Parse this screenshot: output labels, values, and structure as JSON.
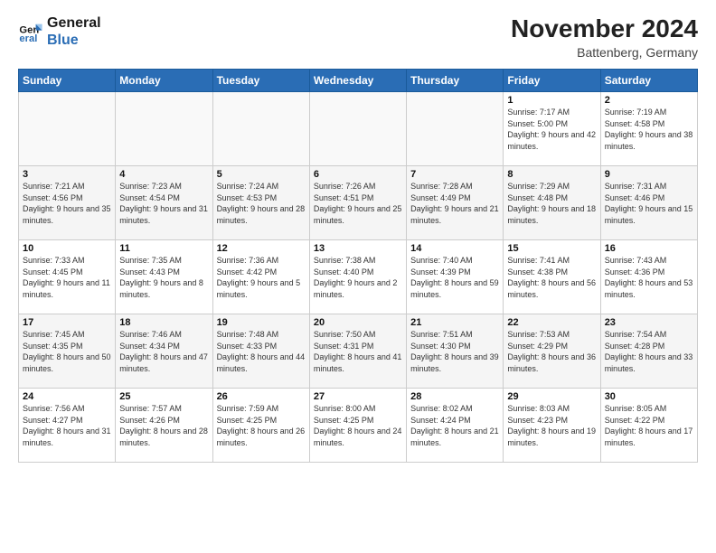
{
  "header": {
    "logo_line1": "General",
    "logo_line2": "Blue",
    "month_year": "November 2024",
    "location": "Battenberg, Germany"
  },
  "weekdays": [
    "Sunday",
    "Monday",
    "Tuesday",
    "Wednesday",
    "Thursday",
    "Friday",
    "Saturday"
  ],
  "weeks": [
    [
      {
        "day": "",
        "info": ""
      },
      {
        "day": "",
        "info": ""
      },
      {
        "day": "",
        "info": ""
      },
      {
        "day": "",
        "info": ""
      },
      {
        "day": "",
        "info": ""
      },
      {
        "day": "1",
        "info": "Sunrise: 7:17 AM\nSunset: 5:00 PM\nDaylight: 9 hours and 42 minutes."
      },
      {
        "day": "2",
        "info": "Sunrise: 7:19 AM\nSunset: 4:58 PM\nDaylight: 9 hours and 38 minutes."
      }
    ],
    [
      {
        "day": "3",
        "info": "Sunrise: 7:21 AM\nSunset: 4:56 PM\nDaylight: 9 hours and 35 minutes."
      },
      {
        "day": "4",
        "info": "Sunrise: 7:23 AM\nSunset: 4:54 PM\nDaylight: 9 hours and 31 minutes."
      },
      {
        "day": "5",
        "info": "Sunrise: 7:24 AM\nSunset: 4:53 PM\nDaylight: 9 hours and 28 minutes."
      },
      {
        "day": "6",
        "info": "Sunrise: 7:26 AM\nSunset: 4:51 PM\nDaylight: 9 hours and 25 minutes."
      },
      {
        "day": "7",
        "info": "Sunrise: 7:28 AM\nSunset: 4:49 PM\nDaylight: 9 hours and 21 minutes."
      },
      {
        "day": "8",
        "info": "Sunrise: 7:29 AM\nSunset: 4:48 PM\nDaylight: 9 hours and 18 minutes."
      },
      {
        "day": "9",
        "info": "Sunrise: 7:31 AM\nSunset: 4:46 PM\nDaylight: 9 hours and 15 minutes."
      }
    ],
    [
      {
        "day": "10",
        "info": "Sunrise: 7:33 AM\nSunset: 4:45 PM\nDaylight: 9 hours and 11 minutes."
      },
      {
        "day": "11",
        "info": "Sunrise: 7:35 AM\nSunset: 4:43 PM\nDaylight: 9 hours and 8 minutes."
      },
      {
        "day": "12",
        "info": "Sunrise: 7:36 AM\nSunset: 4:42 PM\nDaylight: 9 hours and 5 minutes."
      },
      {
        "day": "13",
        "info": "Sunrise: 7:38 AM\nSunset: 4:40 PM\nDaylight: 9 hours and 2 minutes."
      },
      {
        "day": "14",
        "info": "Sunrise: 7:40 AM\nSunset: 4:39 PM\nDaylight: 8 hours and 59 minutes."
      },
      {
        "day": "15",
        "info": "Sunrise: 7:41 AM\nSunset: 4:38 PM\nDaylight: 8 hours and 56 minutes."
      },
      {
        "day": "16",
        "info": "Sunrise: 7:43 AM\nSunset: 4:36 PM\nDaylight: 8 hours and 53 minutes."
      }
    ],
    [
      {
        "day": "17",
        "info": "Sunrise: 7:45 AM\nSunset: 4:35 PM\nDaylight: 8 hours and 50 minutes."
      },
      {
        "day": "18",
        "info": "Sunrise: 7:46 AM\nSunset: 4:34 PM\nDaylight: 8 hours and 47 minutes."
      },
      {
        "day": "19",
        "info": "Sunrise: 7:48 AM\nSunset: 4:33 PM\nDaylight: 8 hours and 44 minutes."
      },
      {
        "day": "20",
        "info": "Sunrise: 7:50 AM\nSunset: 4:31 PM\nDaylight: 8 hours and 41 minutes."
      },
      {
        "day": "21",
        "info": "Sunrise: 7:51 AM\nSunset: 4:30 PM\nDaylight: 8 hours and 39 minutes."
      },
      {
        "day": "22",
        "info": "Sunrise: 7:53 AM\nSunset: 4:29 PM\nDaylight: 8 hours and 36 minutes."
      },
      {
        "day": "23",
        "info": "Sunrise: 7:54 AM\nSunset: 4:28 PM\nDaylight: 8 hours and 33 minutes."
      }
    ],
    [
      {
        "day": "24",
        "info": "Sunrise: 7:56 AM\nSunset: 4:27 PM\nDaylight: 8 hours and 31 minutes."
      },
      {
        "day": "25",
        "info": "Sunrise: 7:57 AM\nSunset: 4:26 PM\nDaylight: 8 hours and 28 minutes."
      },
      {
        "day": "26",
        "info": "Sunrise: 7:59 AM\nSunset: 4:25 PM\nDaylight: 8 hours and 26 minutes."
      },
      {
        "day": "27",
        "info": "Sunrise: 8:00 AM\nSunset: 4:25 PM\nDaylight: 8 hours and 24 minutes."
      },
      {
        "day": "28",
        "info": "Sunrise: 8:02 AM\nSunset: 4:24 PM\nDaylight: 8 hours and 21 minutes."
      },
      {
        "day": "29",
        "info": "Sunrise: 8:03 AM\nSunset: 4:23 PM\nDaylight: 8 hours and 19 minutes."
      },
      {
        "day": "30",
        "info": "Sunrise: 8:05 AM\nSunset: 4:22 PM\nDaylight: 8 hours and 17 minutes."
      }
    ]
  ]
}
